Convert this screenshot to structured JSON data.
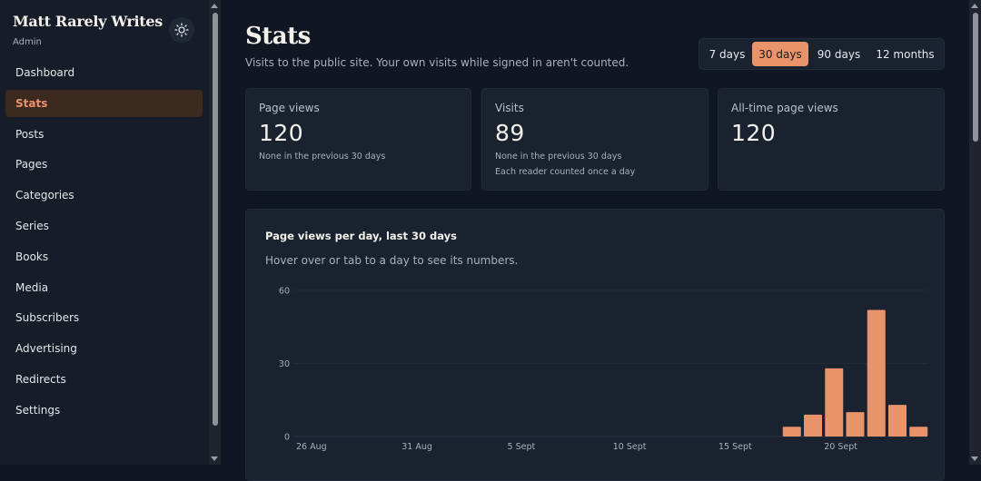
{
  "sidebar": {
    "brand": "Matt Rarely Writes",
    "role": "Admin",
    "theme_toggle_icon": "sun-icon",
    "items": [
      {
        "label": "Dashboard",
        "active": false
      },
      {
        "label": "Stats",
        "active": true
      },
      {
        "label": "Posts",
        "active": false
      },
      {
        "label": "Pages",
        "active": false
      },
      {
        "label": "Categories",
        "active": false
      },
      {
        "label": "Series",
        "active": false
      },
      {
        "label": "Books",
        "active": false
      },
      {
        "label": "Media",
        "active": false
      },
      {
        "label": "Subscribers",
        "active": false
      },
      {
        "label": "Advertising",
        "active": false
      },
      {
        "label": "Redirects",
        "active": false
      },
      {
        "label": "Settings",
        "active": false
      }
    ]
  },
  "header": {
    "title": "Stats",
    "subtitle": "Visits to the public site. Your own visits while signed in aren't counted."
  },
  "range": {
    "options": [
      "7 days",
      "30 days",
      "90 days",
      "12 months"
    ],
    "selected": "30 days"
  },
  "cards": {
    "page_views": {
      "label": "Page views",
      "value": "120",
      "note1": "None in the previous 30 days"
    },
    "visits": {
      "label": "Visits",
      "value": "89",
      "note1": "None in the previous 30 days",
      "note2": "Each reader counted once a day"
    },
    "all_time": {
      "label": "All-time page views",
      "value": "120"
    }
  },
  "chart": {
    "title": "Page views per day, last 30 days",
    "help": "Hover over or tab to a day to see its numbers."
  },
  "colors": {
    "accent": "#e9936b",
    "background": "#111722",
    "card": "#1a2230"
  },
  "chart_data": {
    "type": "bar",
    "title": "Page views per day, last 30 days",
    "xlabel": "",
    "ylabel": "",
    "ylim": [
      0,
      60
    ],
    "yticks": [
      0,
      30,
      60
    ],
    "x_tick_labels": [
      {
        "index": 0,
        "label": "26 Aug"
      },
      {
        "index": 5,
        "label": "31 Aug"
      },
      {
        "index": 10,
        "label": "5 Sept"
      },
      {
        "index": 15,
        "label": "10 Sept"
      },
      {
        "index": 20,
        "label": "15 Sept"
      },
      {
        "index": 25,
        "label": "20 Sept"
      }
    ],
    "categories": [
      "26 Aug",
      "27 Aug",
      "28 Aug",
      "29 Aug",
      "30 Aug",
      "31 Aug",
      "1 Sept",
      "2 Sept",
      "3 Sept",
      "4 Sept",
      "5 Sept",
      "6 Sept",
      "7 Sept",
      "8 Sept",
      "9 Sept",
      "10 Sept",
      "11 Sept",
      "12 Sept",
      "13 Sept",
      "14 Sept",
      "15 Sept",
      "16 Sept",
      "17 Sept",
      "18 Sept",
      "19 Sept",
      "20 Sept",
      "21 Sept",
      "22 Sept",
      "23 Sept",
      "24 Sept"
    ],
    "values": [
      0,
      0,
      0,
      0,
      0,
      0,
      0,
      0,
      0,
      0,
      0,
      0,
      0,
      0,
      0,
      0,
      0,
      0,
      0,
      0,
      0,
      0,
      0,
      4,
      9,
      28,
      10,
      52,
      13,
      4
    ],
    "grid": true
  }
}
